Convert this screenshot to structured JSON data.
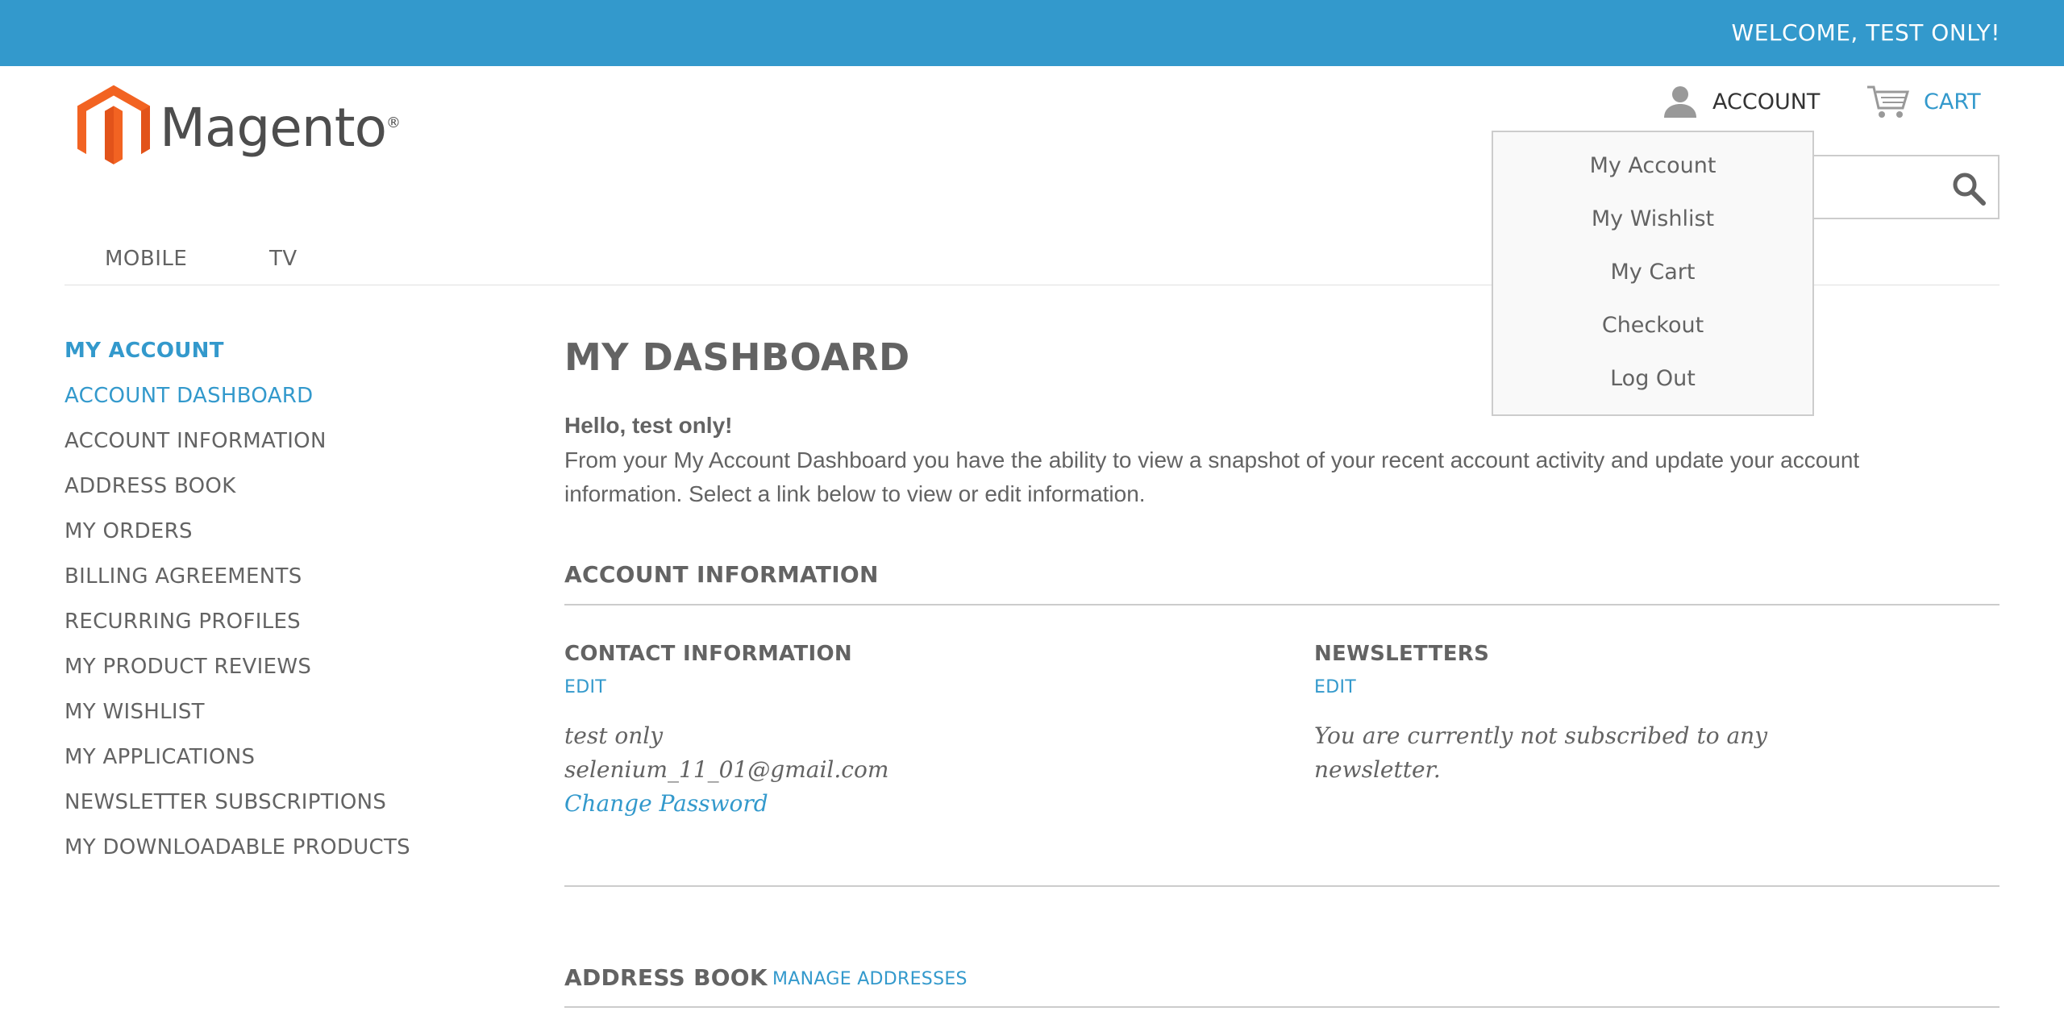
{
  "header": {
    "welcome": "WELCOME, TEST ONLY!",
    "logo_text": "Magento",
    "logo_mark": "®",
    "account_label": "ACCOUNT",
    "cart_label": "CART",
    "search_placeholder": ""
  },
  "nav": {
    "items": [
      "MOBILE",
      "TV"
    ]
  },
  "account_dropdown": {
    "items": [
      "My Account",
      "My Wishlist",
      "My Cart",
      "Checkout",
      "Log Out"
    ]
  },
  "sidebar": {
    "title": "MY ACCOUNT",
    "items": [
      "ACCOUNT DASHBOARD",
      "ACCOUNT INFORMATION",
      "ADDRESS BOOK",
      "MY ORDERS",
      "BILLING AGREEMENTS",
      "RECURRING PROFILES",
      "MY PRODUCT REVIEWS",
      "MY WISHLIST",
      "MY APPLICATIONS",
      "NEWSLETTER SUBSCRIPTIONS",
      "MY DOWNLOADABLE PRODUCTS"
    ]
  },
  "main": {
    "title": "MY DASHBOARD",
    "hello": "Hello, test only!",
    "intro": "From your My Account Dashboard you have the ability to view a snapshot of your recent account activity and update your account information. Select a link below to view or edit information.",
    "account_info_title": "ACCOUNT INFORMATION",
    "contact": {
      "title": "CONTACT INFORMATION",
      "edit": "EDIT",
      "name": "test only",
      "email": "selenium_11_01@gmail.com",
      "change_password": "Change Password"
    },
    "newsletters": {
      "title": "NEWSLETTERS",
      "edit": "EDIT",
      "line1": "You are currently not subscribed to any",
      "line2": "newsletter."
    },
    "address_book": {
      "title": "ADDRESS BOOK",
      "manage": "MANAGE ADDRESSES"
    }
  },
  "colors": {
    "accent": "#3399cc",
    "text": "#636363",
    "logo_orange": "#f26322"
  }
}
